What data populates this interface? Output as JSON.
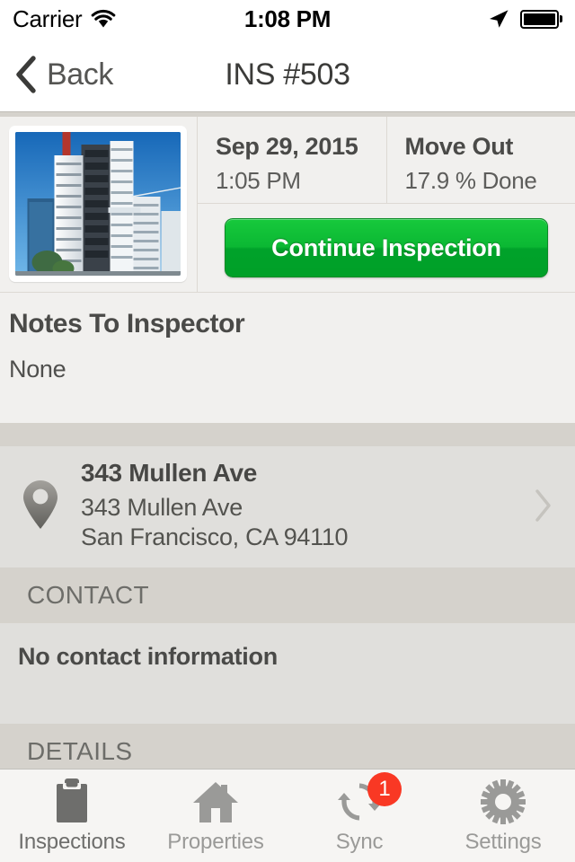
{
  "status_bar": {
    "carrier": "Carrier",
    "wifi_icon": "wifi-icon",
    "time": "1:08 PM",
    "location_icon": "location-arrow-icon",
    "battery_icon": "battery-full-icon"
  },
  "nav": {
    "back_icon": "chevron-left-icon",
    "back_label": "Back",
    "title": "INS #503"
  },
  "summary": {
    "thumbnail_name": "property-photo-thumbnail",
    "date": "Sep 29, 2015",
    "time": "1:05 PM",
    "type": "Move Out",
    "progress": "17.9 % Done",
    "continue_label": "Continue Inspection",
    "continue_color": "#0bb833"
  },
  "notes": {
    "title": "Notes To Inspector",
    "body": "None"
  },
  "address": {
    "pin_icon": "map-pin-icon",
    "name": "343 Mullen Ave",
    "street": "343 Mullen Ave",
    "city_state_zip": "San Francisco, CA 94110",
    "chevron_icon": "chevron-right-icon"
  },
  "contact": {
    "header": "CONTACT",
    "body": "No contact information"
  },
  "details": {
    "header": "DETAILS"
  },
  "tabbar": {
    "tabs": [
      {
        "label": "Inspections",
        "icon": "clipboard-icon",
        "selected": true,
        "badge": ""
      },
      {
        "label": "Properties",
        "icon": "house-icon",
        "selected": false,
        "badge": ""
      },
      {
        "label": "Sync",
        "icon": "sync-icon",
        "selected": false,
        "badge": "1"
      },
      {
        "label": "Settings",
        "icon": "gear-icon",
        "selected": false,
        "badge": ""
      }
    ],
    "badge_color": "#f93824"
  }
}
